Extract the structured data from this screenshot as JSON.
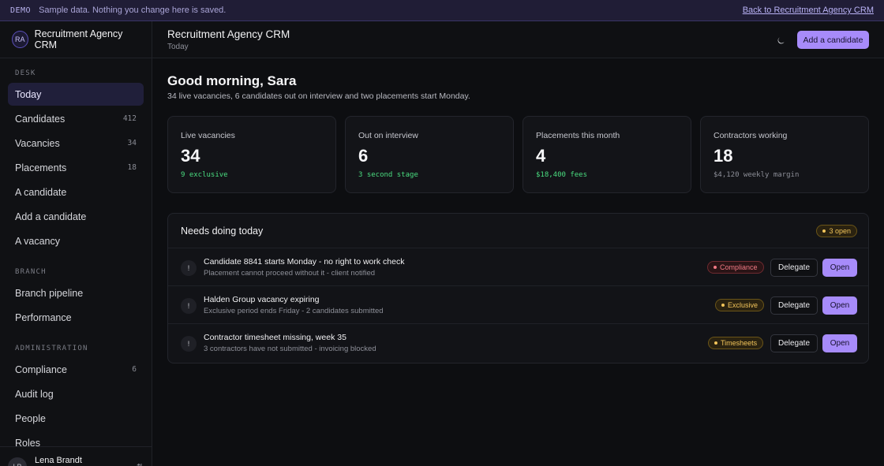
{
  "banner": {
    "tag": "DEMO",
    "message": "Sample data. Nothing you change here is saved.",
    "back_link": "Back to Recruitment Agency CRM"
  },
  "app": {
    "initials": "RA",
    "name": "Recruitment Agency CRM"
  },
  "sidebar": {
    "sections": [
      {
        "label": "DESK",
        "items": [
          {
            "label": "Today",
            "count": "",
            "active": true
          },
          {
            "label": "Candidates",
            "count": "412"
          },
          {
            "label": "Vacancies",
            "count": "34"
          },
          {
            "label": "Placements",
            "count": "18"
          },
          {
            "label": "A candidate",
            "count": ""
          },
          {
            "label": "Add a candidate",
            "count": ""
          },
          {
            "label": "A vacancy",
            "count": ""
          }
        ]
      },
      {
        "label": "BRANCH",
        "items": [
          {
            "label": "Branch pipeline",
            "count": ""
          },
          {
            "label": "Performance",
            "count": ""
          }
        ]
      },
      {
        "label": "ADMINISTRATION",
        "items": [
          {
            "label": "Compliance",
            "count": "6"
          },
          {
            "label": "Audit log",
            "count": ""
          },
          {
            "label": "People",
            "count": ""
          },
          {
            "label": "Roles",
            "count": ""
          }
        ]
      }
    ],
    "user": {
      "initials": "LB",
      "name": "Lena Brandt",
      "icon": "swap-icon"
    }
  },
  "topbar": {
    "title": "Recruitment Agency CRM",
    "subtitle": "Today",
    "theme_icon": "moon-icon",
    "primary_action": "Add a candidate"
  },
  "main": {
    "greeting": "Good morning, Sara",
    "summary": "34 live vacancies, 6 candidates out on interview and two placements start Monday.",
    "stats": [
      {
        "label": "Live vacancies",
        "value": "34",
        "note": "9 exclusive",
        "note_color": "#4ade80"
      },
      {
        "label": "Out on interview",
        "value": "6",
        "note": "3 second stage",
        "note_color": "#4ade80"
      },
      {
        "label": "Placements this month",
        "value": "4",
        "note": "$18,400 fees",
        "note_color": "#4ade80"
      },
      {
        "label": "Contractors working",
        "value": "18",
        "note": "$4,120 weekly margin",
        "note_color": "#8d8f98"
      }
    ],
    "todo": {
      "title": "Needs doing today",
      "badge": "3 open",
      "tasks": [
        {
          "icon": "alert-icon",
          "title": "Candidate 8841 starts Monday - no right to work check",
          "detail": "Placement cannot proceed without it - client notified",
          "tag": "Compliance",
          "tag_color": "#f27a85",
          "delegate": "Delegate",
          "open": "Open"
        },
        {
          "icon": "alert-icon",
          "title": "Halden Group vacancy expiring",
          "detail": "Exclusive period ends Friday - 2 candidates submitted",
          "tag": "Exclusive",
          "tag_color": "#f2c45a",
          "delegate": "Delegate",
          "open": "Open"
        },
        {
          "icon": "alert-icon",
          "title": "Contractor timesheet missing, week 35",
          "detail": "3 contractors have not submitted - invoicing blocked",
          "tag": "Timesheets",
          "tag_color": "#f2c45a",
          "delegate": "Delegate",
          "open": "Open"
        }
      ]
    }
  }
}
